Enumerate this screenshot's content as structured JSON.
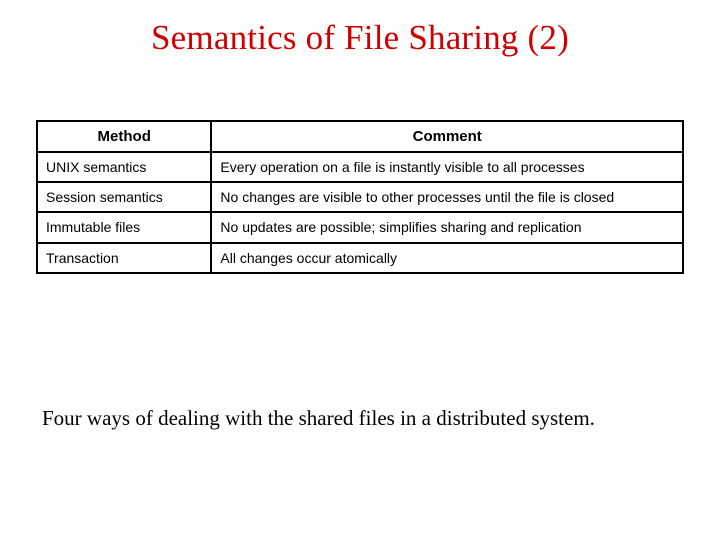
{
  "title": "Semantics of File Sharing (2)",
  "table": {
    "headers": {
      "method": "Method",
      "comment": "Comment"
    },
    "rows": [
      {
        "method": "UNIX semantics",
        "comment": "Every operation on a file is instantly visible to all processes"
      },
      {
        "method": "Session semantics",
        "comment": "No changes are visible to other processes until the file is closed"
      },
      {
        "method": "Immutable files",
        "comment": "No updates are possible; simplifies sharing and replication"
      },
      {
        "method": "Transaction",
        "comment": "All changes occur atomically"
      }
    ]
  },
  "caption": "Four ways of dealing with the shared files in a distributed system."
}
